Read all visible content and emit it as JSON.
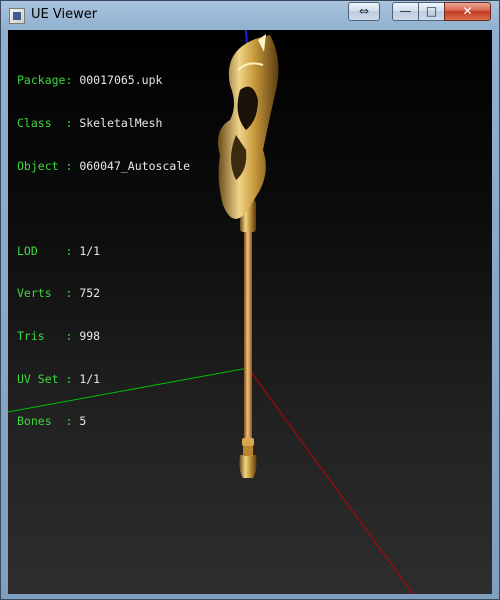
{
  "window": {
    "title": "UE Viewer",
    "buttons": {
      "move": "⇔",
      "minimize": "—",
      "maximize": "□",
      "close": "✕"
    }
  },
  "info_block_1": [
    {
      "label": "Package:",
      "value": "00017065.upk"
    },
    {
      "label": "Class  :",
      "value": "SkeletalMesh"
    },
    {
      "label": "Object :",
      "value": "060047_Autoscale"
    }
  ],
  "info_block_2": [
    {
      "label": "LOD    :",
      "value": "1/1"
    },
    {
      "label": "Verts  :",
      "value": "752"
    },
    {
      "label": "Tris   :",
      "value": "998"
    },
    {
      "label": "UV Set :",
      "value": "1/1"
    },
    {
      "label": "Bones  :",
      "value": "5"
    }
  ],
  "colors": {
    "label_green": "#3fd83f",
    "value_white": "#e8e8e8",
    "axis_x": "#c00000",
    "axis_y": "#00c000",
    "axis_z": "#0000d0",
    "mesh_gold": "#c89a3c"
  }
}
